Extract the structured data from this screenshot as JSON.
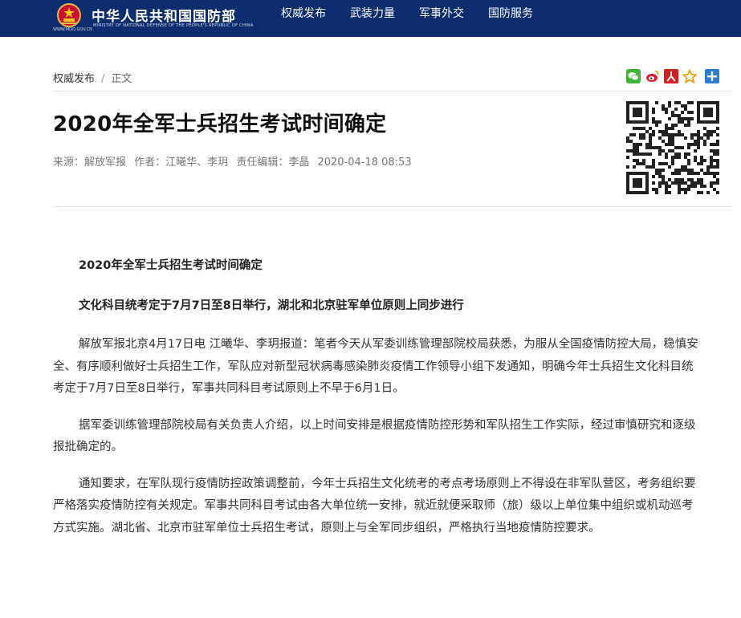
{
  "header": {
    "site_name_cn": "中华人民共和国国防部",
    "site_name_en": "MINISTRY OF NATIONAL DEFENSE OF THE PEOPLE'S REPUBLIC OF CHINA",
    "site_url": "WWW.MOD.GOV.CN",
    "nav": [
      {
        "label": "权威发布"
      },
      {
        "label": "武装力量"
      },
      {
        "label": "军事外交"
      },
      {
        "label": "国防服务"
      }
    ],
    "background": "#0d2d6e"
  },
  "breadcrumb": {
    "home": "权威发布",
    "separator": "/",
    "current": "正文"
  },
  "share_icons": [
    "wechat-icon",
    "weibo-icon",
    "people-icon",
    "star-icon",
    "plus-icon"
  ],
  "article": {
    "title": "2020年全军士兵招生考试时间确定",
    "meta": {
      "source": "来源：解放军报",
      "author": "作者：江曦华、李玥",
      "editor": "责任编辑：李晶",
      "date": "2020-04-18 08:53"
    },
    "heading1": "2020年全军士兵招生考试时间确定",
    "heading2": "文化科目统考定于7月7日至8日举行，湖北和北京驻军单位原则上同步进行",
    "paragraphs": [
      "解放军报北京4月17日电 江曦华、李玥报道：笔者今天从军委训练管理部院校局获悉，为服从全国疫情防控大局，稳慎安全、有序顺利做好士兵招生工作，军队应对新型冠状病毒感染肺炎疫情工作领导小组下发通知，明确今年士兵招生文化科目统考定于7月7日至8日举行，军事共同科目考试原则上不早于6月1日。",
      "据军委训练管理部院校局有关负责人介绍，以上时间安排是根据疫情防控形势和军队招生工作实际，经过审慎研究和逐级报批确定的。",
      "通知要求，在军队现行疫情防控政策调整前，今年士兵招生文化统考的考点考场原则上不得设在非军队营区，考务组织要严格落实疫情防控有关规定。军事共同科目考试由各大单位统一安排，就近就便采取师（旅）级以上单位集中组织或机动巡考方式实施。湖北省、北京市驻军单位士兵招生考试，原则上与全军同步组织，严格执行当地疫情防控要求。"
    ]
  }
}
